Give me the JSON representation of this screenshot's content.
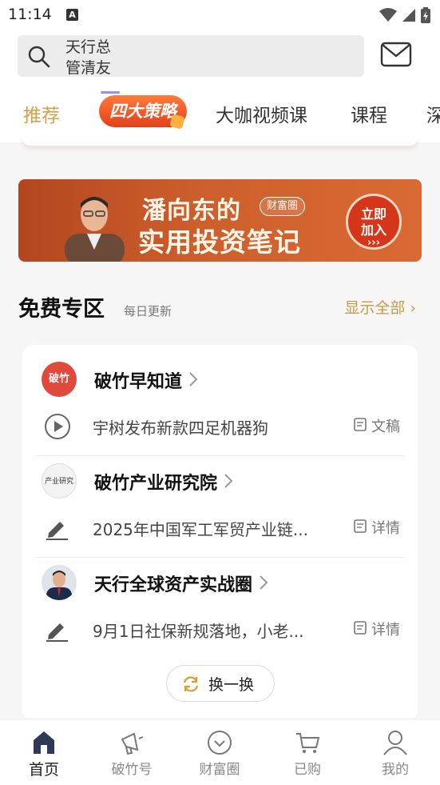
{
  "status_bar": {
    "time": "11:14",
    "notification_glyph": "A"
  },
  "search": {
    "scroll_lines": [
      "天行总",
      "管清友"
    ]
  },
  "tabs": [
    {
      "label": "推荐",
      "active": true
    },
    {
      "label": "四大策略",
      "highlight": true
    },
    {
      "label": "大咖视频课"
    },
    {
      "label": "课程"
    },
    {
      "label": "深"
    }
  ],
  "banner": {
    "line1": "潘向东的",
    "line2": "实用投资笔记",
    "tag": "财富圈",
    "cta_line1": "立即",
    "cta_line2": "加入",
    "cta_arrows": "›››"
  },
  "section": {
    "title": "免费专区",
    "subtitle": "每日更新",
    "more": "显示全部 ›"
  },
  "items": [
    {
      "name": "破竹早知道",
      "avatar_text": "破竹",
      "desc": "宇树发布新款四足机器狗",
      "action": "文稿",
      "row_icon": "play-icon"
    },
    {
      "name": "破竹产业研究院",
      "avatar_text": "产业研究院",
      "desc": "2025年中国军工军贸产业链...",
      "action": "详情",
      "row_icon": "edit-icon"
    },
    {
      "name": "天行全球资产实战圈",
      "avatar_text": "",
      "desc": "9月1日社保新规落地，小老...",
      "action": "详情",
      "row_icon": "edit-icon"
    }
  ],
  "refresh_label": "换一换",
  "bottom_nav": [
    {
      "label": "首页",
      "icon": "home-icon",
      "active": true
    },
    {
      "label": "破竹号",
      "icon": "megaphone-icon"
    },
    {
      "label": "财富圈",
      "icon": "circle-icon"
    },
    {
      "label": "已购",
      "icon": "cart-icon"
    },
    {
      "label": "我的",
      "icon": "user-icon"
    }
  ],
  "colors": {
    "accent": "#d5a04a",
    "banner": "#cd5f2d",
    "pill": "#e2411b"
  }
}
